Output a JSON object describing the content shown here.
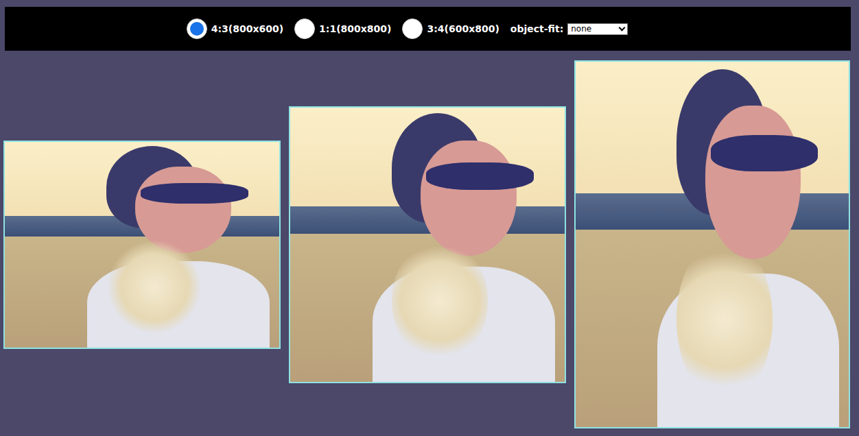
{
  "toolbar": {
    "radios": [
      {
        "label": "4:3(800x600)",
        "selected": true
      },
      {
        "label": "1:1(800x800)",
        "selected": false
      },
      {
        "label": "3:4(600x800)",
        "selected": false
      }
    ],
    "object_fit": {
      "label": "object-fit:",
      "value": "none"
    }
  }
}
